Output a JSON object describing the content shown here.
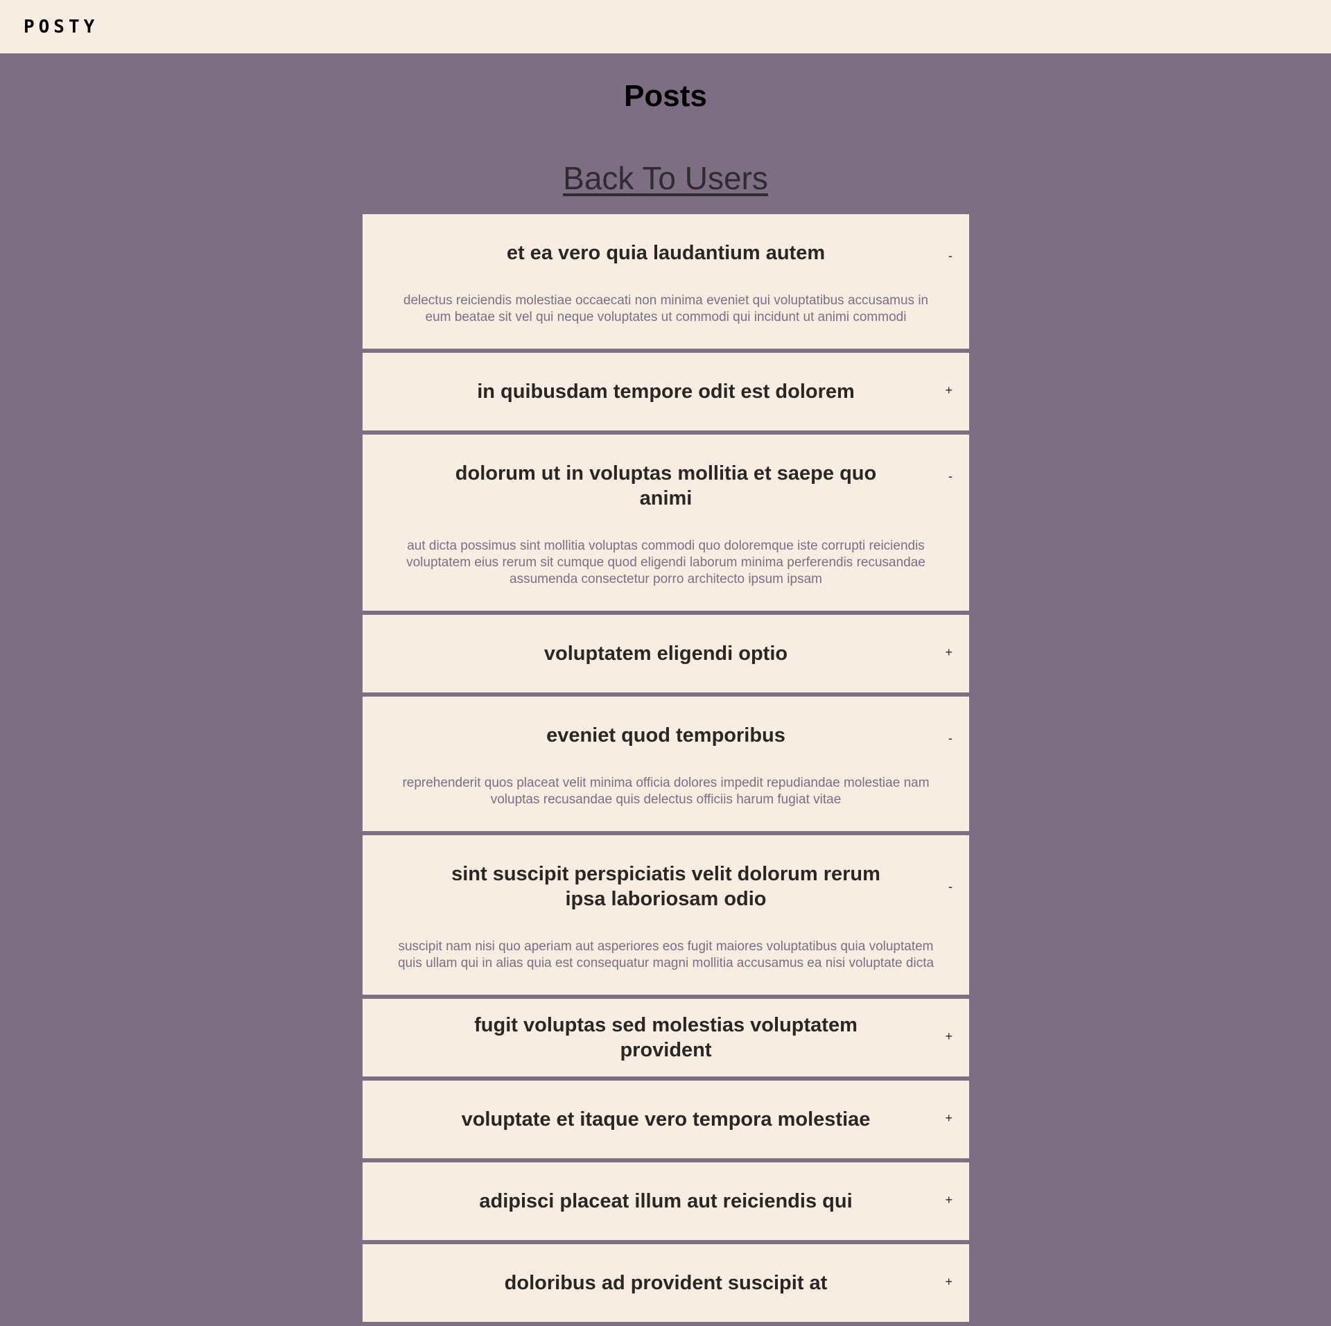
{
  "header": {
    "logo": "POSTY"
  },
  "main": {
    "title": "Posts",
    "back_link": "Back To Users"
  },
  "posts": [
    {
      "title": "et ea vero quia laudantium autem",
      "toggle": "-",
      "body": "delectus reiciendis molestiae occaecati non minima eveniet qui voluptatibus accusamus in eum beatae sit vel qui neque voluptates ut commodi qui incidunt ut animi commodi"
    },
    {
      "title": "in quibusdam tempore odit est dolorem",
      "toggle": "+"
    },
    {
      "title": "dolorum ut in voluptas mollitia et saepe quo animi",
      "toggle": "-",
      "body": "aut dicta possimus sint mollitia voluptas commodi quo doloremque iste corrupti reiciendis voluptatem eius rerum sit cumque quod eligendi laborum minima perferendis recusandae assumenda consectetur porro architecto ipsum ipsam"
    },
    {
      "title": "voluptatem eligendi optio",
      "toggle": "+"
    },
    {
      "title": "eveniet quod temporibus",
      "toggle": "-",
      "body": "reprehenderit quos placeat velit minima officia dolores impedit repudiandae molestiae nam voluptas recusandae quis delectus officiis harum fugiat vitae"
    },
    {
      "title": "sint suscipit perspiciatis velit dolorum rerum ipsa laboriosam odio",
      "toggle": "-",
      "body": "suscipit nam nisi quo aperiam aut asperiores eos fugit maiores voluptatibus quia voluptatem quis ullam qui in alias quia est consequatur magni mollitia accusamus ea nisi voluptate dicta"
    },
    {
      "title": "fugit voluptas sed molestias voluptatem provident",
      "toggle": "+"
    },
    {
      "title": "voluptate et itaque vero tempora molestiae",
      "toggle": "+"
    },
    {
      "title": "adipisci placeat illum aut reiciendis qui",
      "toggle": "+"
    },
    {
      "title": "doloribus ad provident suscipit at",
      "toggle": "+"
    }
  ]
}
